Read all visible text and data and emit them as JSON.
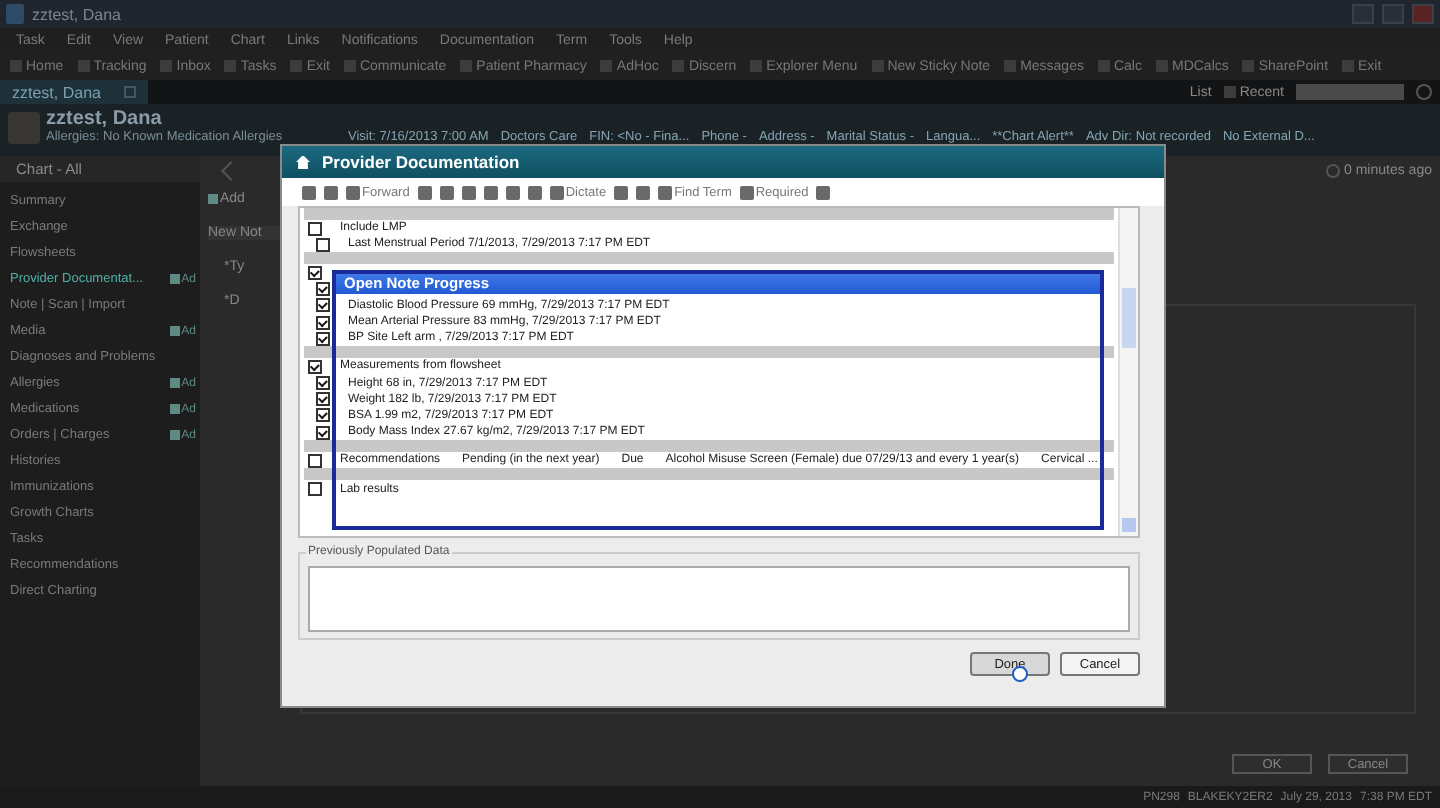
{
  "window": {
    "title": "zztest, Dana"
  },
  "menu": [
    "Task",
    "Edit",
    "View",
    "Patient",
    "Chart",
    "Links",
    "Notifications",
    "Documentation",
    "Term",
    "Tools",
    "Help"
  ],
  "toolbar": [
    "Home",
    "Tracking",
    "Inbox",
    "Tasks",
    "Exit",
    "Communicate",
    "Patient Pharmacy",
    "AdHoc",
    "Discern",
    "Explorer Menu",
    "New Sticky Note",
    "Messages",
    "Calc",
    "MDCalcs",
    "SharePoint",
    "Exit"
  ],
  "patient_tab": {
    "label": "zztest, Dana"
  },
  "tab_row": {
    "list": "List",
    "recent": "Recent"
  },
  "banner": {
    "name": "zztest, Dana",
    "allergies": "Allergies: No Known Medication Allergies",
    "fields": [
      "Visit: 7/16/2013 7:00 AM",
      "Doctors Care",
      "FIN: <No - Fina...",
      "Phone -",
      "Address -",
      "Marital Status -",
      "Langua...",
      "**Chart Alert**",
      "Adv Dir: Not recorded",
      "No External D..."
    ]
  },
  "sidebar": {
    "header": "Chart - All",
    "items": [
      {
        "label": "Summary",
        "selected": false
      },
      {
        "label": "Exchange",
        "selected": false
      },
      {
        "label": "Flowsheets",
        "selected": false
      },
      {
        "label": "Provider Documentat...",
        "selected": true,
        "add": "Ad"
      },
      {
        "label": "Note | Scan | Import",
        "selected": false
      },
      {
        "label": "Media",
        "selected": false,
        "add": "Ad"
      },
      {
        "label": "Diagnoses and Problems",
        "selected": false
      },
      {
        "label": "Allergies",
        "selected": false,
        "add": "Ad"
      },
      {
        "label": "Medications",
        "selected": false,
        "add": "Ad"
      },
      {
        "label": "Orders | Charges",
        "selected": false,
        "add": "Ad"
      },
      {
        "label": "Histories",
        "selected": false
      },
      {
        "label": "Immunizations",
        "selected": false
      },
      {
        "label": "Growth Charts",
        "selected": false
      },
      {
        "label": "Tasks",
        "selected": false
      },
      {
        "label": "Recommendations",
        "selected": false
      },
      {
        "label": "Direct Charting",
        "selected": false
      }
    ]
  },
  "main": {
    "add": "Add",
    "note_tab": "New Not",
    "field_1": "*Ty",
    "field_2": "*D",
    "updated": "0 minutes ago",
    "buttons": [
      "OK",
      "Cancel"
    ]
  },
  "dialog": {
    "title": "Provider Documentation",
    "toolbar": [
      {
        "kind": "icon"
      },
      {
        "kind": "icon"
      },
      {
        "kind": "labeled",
        "label": "Forward"
      },
      {
        "kind": "icon"
      },
      {
        "kind": "icon"
      },
      {
        "kind": "icon"
      },
      {
        "kind": "icon"
      },
      {
        "kind": "icon"
      },
      {
        "kind": "icon"
      },
      {
        "kind": "labeled",
        "label": "Dictate"
      },
      {
        "kind": "icon"
      },
      {
        "kind": "icon"
      },
      {
        "kind": "labeled",
        "label": "Find Term"
      },
      {
        "kind": "labeled",
        "label": "Required"
      },
      {
        "kind": "icon"
      }
    ],
    "groups": [
      {
        "label": "Include LMP",
        "checked": false,
        "children": [
          {
            "label": "Last Menstrual Period  7/1/2013,  7/29/2013 7:17 PM EDT",
            "checked": false
          }
        ]
      },
      {
        "checked": true,
        "children": [
          {
            "checked": true
          },
          {
            "label": "Diastolic Blood Pressure  69 mmHg,  7/29/2013 7:17 PM EDT",
            "checked": true
          },
          {
            "label": "Mean Arterial Pressure  83 mmHg,  7/29/2013 7:17 PM EDT",
            "checked": true
          },
          {
            "label": "BP Site  Left arm ,  7/29/2013 7:17 PM EDT",
            "checked": true
          }
        ]
      },
      {
        "label": "Measurements from flowsheet",
        "checked": true,
        "children": [
          {
            "label": "Height  68 in,  7/29/2013 7:17 PM EDT",
            "checked": true
          },
          {
            "label": "Weight  182 lb,  7/29/2013 7:17 PM EDT",
            "checked": true
          },
          {
            "label": "BSA  1.99 m2,  7/29/2013 7:17 PM EDT",
            "checked": true
          },
          {
            "label": "Body Mass Index  27.67 kg/m2,  7/29/2013 7:17 PM EDT",
            "checked": true
          }
        ]
      },
      {
        "label": "Recommendations",
        "checked": false,
        "cells": [
          "Pending (in the next year)",
          "Due",
          "Alcohol Misuse Screen (Female) due  07/29/13  and every 1  year(s)",
          "Cervical ..."
        ]
      },
      {
        "label": "Lab results",
        "checked": false
      }
    ],
    "progress": {
      "title": "Open Note Progress"
    },
    "previous": {
      "label": "Previously Populated Data"
    },
    "buttons": [
      {
        "label": "Done",
        "hover": true
      },
      {
        "label": "Cancel",
        "hover": false
      }
    ]
  },
  "status_bar": [
    "PN298",
    "BLAKEKY2ER2",
    "July 29, 2013",
    "7:38 PM EDT"
  ]
}
